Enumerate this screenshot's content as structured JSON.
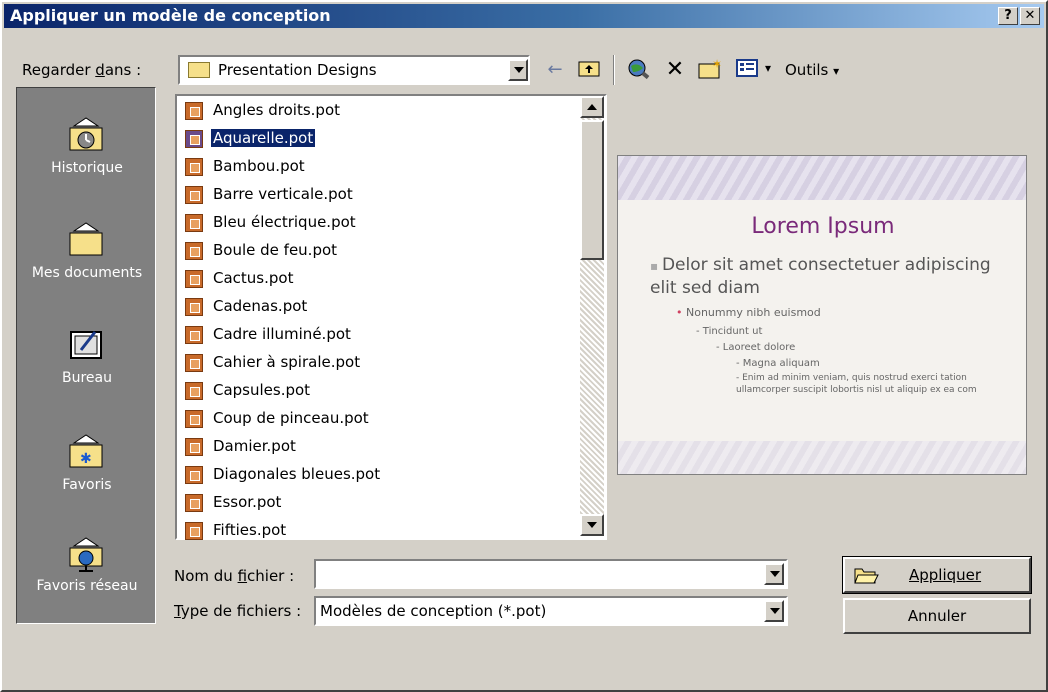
{
  "window": {
    "title": "Appliquer un modèle de conception",
    "help_btn": "?",
    "close_btn": "✕"
  },
  "lookin": {
    "label": "Regarder dans :",
    "value": "Presentation Designs"
  },
  "toolbar": {
    "tools_label": "Outils",
    "tools_arrow": "▾",
    "views_arrow": "▾"
  },
  "places": [
    {
      "label": "Historique",
      "icon": "history-icon"
    },
    {
      "label": "Mes documents",
      "icon": "my-documents-icon"
    },
    {
      "label": "Bureau",
      "icon": "desktop-icon"
    },
    {
      "label": "Favoris",
      "icon": "favorites-icon"
    },
    {
      "label": "Favoris réseau",
      "icon": "network-favorites-icon"
    }
  ],
  "files": [
    "Angles droits.pot",
    "Aquarelle.pot",
    "Bambou.pot",
    "Barre verticale.pot",
    "Bleu électrique.pot",
    "Boule de feu.pot",
    "Cactus.pot",
    "Cadenas.pot",
    "Cadre illuminé.pot",
    "Cahier à spirale.pot",
    "Capsules.pot",
    "Coup de pinceau.pot",
    "Damier.pot",
    "Diagonales bleues.pot",
    "Essor.pot",
    "Fifties.pot"
  ],
  "selected_file": "Aquarelle.pot",
  "preview": {
    "title": "Lorem Ipsum",
    "bullet1": "Delor sit amet consectetuer adipiscing elit sed diam",
    "bullet2": "Nonummy nibh euismod",
    "bullet3": "Tincidunt ut",
    "bullet4": "Laoreet dolore",
    "bullet5": "Magna aliquam",
    "bullet6": "Enim ad minim veniam, quis nostrud exerci tation ullamcorper suscipit lobortis nisl ut aliquip ex ea com"
  },
  "filename": {
    "label": "Nom du fichier :",
    "value": ""
  },
  "filetype": {
    "label": "Type de fichiers :",
    "value": "Modèles de conception (*.pot)"
  },
  "buttons": {
    "apply": "Appliquer",
    "cancel": "Annuler"
  }
}
